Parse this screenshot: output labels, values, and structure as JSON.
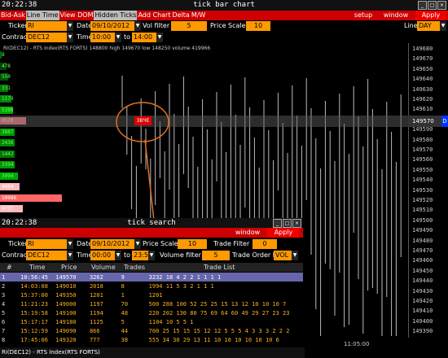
{
  "window": {
    "clock": "20:22:38",
    "title": "tick bar chart"
  },
  "menu": {
    "items": [
      "Bid-Ask",
      "Line Time",
      "View DOM",
      "Hidden Ticks",
      "Add Chart",
      "Delta",
      "M/W"
    ],
    "highlighted": [
      1,
      3
    ],
    "setup": "setup",
    "window": "window",
    "apply": "Apply"
  },
  "controls": {
    "ticker_label": "Ticker",
    "ticker": "RI",
    "date_label": "Date",
    "date": "09/10/2012",
    "vol_filter_label": "Vol filter",
    "vol_filter": "5",
    "price_scale_label": "Price Scale",
    "price_scale": "10",
    "line_label": "Line",
    "line": "DAY",
    "contract_label": "Contract",
    "contract": "DEC12",
    "time_label": "Time",
    "time_from": "10:00",
    "to_label": "to",
    "time_to": "14:00"
  },
  "chart": {
    "info": "RI(DEC12) - RTS Index(RTS FORTS)  148800  high 149670  low 148250  volume 419966",
    "current_price": "149570",
    "d_mark": "D",
    "red_box": "3ВЧЕ",
    "prices": [
      "149680",
      "149670",
      "149650",
      "149640",
      "149630",
      "149620",
      "149610",
      "149600",
      "149590",
      "149580",
      "149570",
      "149560",
      "149550",
      "149540",
      "149530",
      "149520",
      "149510",
      "149500",
      "149490",
      "149480",
      "149470",
      "149460",
      "149450",
      "149440",
      "149430",
      "149420",
      "149410",
      "149400",
      "149390"
    ],
    "volumes": [
      "8",
      "478",
      "550",
      "331",
      "1179",
      "5208",
      "4570",
      "3887",
      "2436",
      "1442",
      "3394",
      "3994",
      "4084",
      "10986",
      "4737"
    ],
    "time_label": "11:05:00"
  },
  "tick_search": {
    "clock": "20:22:38",
    "title": "tick search",
    "window": "window",
    "apply": "Apply",
    "ticker_label": "Ticker",
    "ticker": "RI",
    "date_label": "Date",
    "date": "09/10/2012",
    "price_scale_label": "Price Scale",
    "price_scale": "10",
    "trade_filter_label": "Trade Filter",
    "trade_filter": "0",
    "contract_label": "Contract",
    "contract": "DEC12",
    "time_label": "Time",
    "time_from": "00:00",
    "to_label": "to",
    "time_to": "23:59",
    "volume_filter_label": "Volume filter",
    "volume_filter": "5",
    "trade_order_label": "Trade Order by",
    "trade_order": "VOL",
    "columns": [
      "#",
      "Time",
      "Price",
      "Volume",
      "Trades",
      "Trade List"
    ],
    "rows": [
      [
        "1",
        "10:56:45",
        "149570",
        "3262",
        "9",
        "3232 18 4 2 2 1 1 1 1"
      ],
      [
        "2",
        "14:03:08",
        "149010",
        "2018",
        "8",
        "1994 11 5 3 2 1 1 1"
      ],
      [
        "3",
        "15:37:00",
        "149350",
        "1201",
        "1",
        "1201"
      ],
      [
        "4",
        "11:21:23",
        "149000",
        "1197",
        "70",
        "500 288 100 52 25 25 15 13 12 10 10 10 7"
      ],
      [
        "5",
        "15:19:58",
        "149100",
        "1194",
        "48",
        "220 202 130 80 75 69 64 60 49 29 27 23 23"
      ],
      [
        "6",
        "15:17:17",
        "149180",
        "1125",
        "5",
        "1104 10 5 5 1"
      ],
      [
        "7",
        "15:12:59",
        "149090",
        "866",
        "44",
        "700 25 15 15 15 12 12 5 5 5 4 3 3 3 2 2 2"
      ],
      [
        "8",
        "17:45:06",
        "149320",
        "777",
        "38",
        "555 34 30 29 13 11 10 10 10 10 10 10 6"
      ]
    ],
    "status": "RI(DEC12) - RTS Index(RTS FORTS)"
  }
}
